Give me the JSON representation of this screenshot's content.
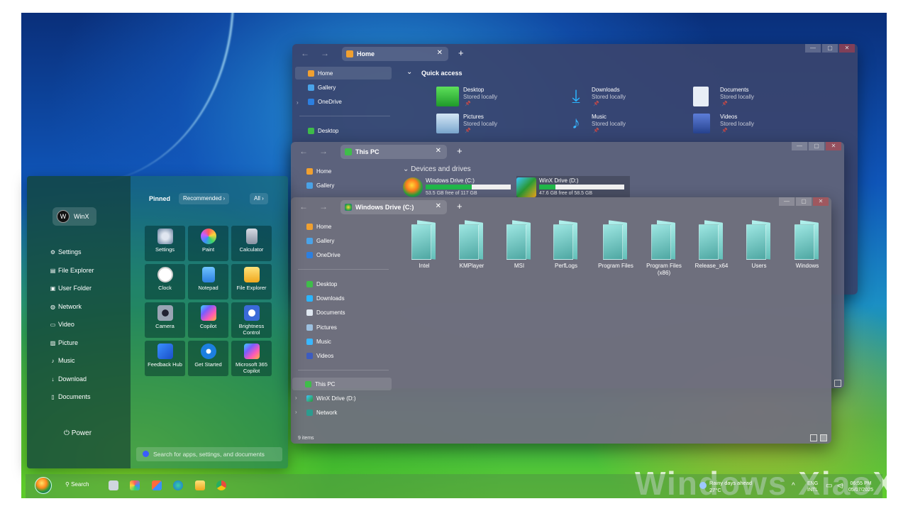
{
  "colors": {
    "accent_green": "#21b84a",
    "close_red": "#dc3c3c"
  },
  "home_window": {
    "tab_label": "Home",
    "sidebar": [
      "Home",
      "Gallery",
      "OneDrive",
      "Desktop"
    ],
    "quick_access_title": "Quick access",
    "items": [
      {
        "name": "Desktop",
        "sub": "Stored locally"
      },
      {
        "name": "Downloads",
        "sub": "Stored locally"
      },
      {
        "name": "Documents",
        "sub": "Stored locally"
      },
      {
        "name": "Pictures",
        "sub": "Stored locally"
      },
      {
        "name": "Music",
        "sub": "Stored locally"
      },
      {
        "name": "Videos",
        "sub": "Stored locally"
      }
    ]
  },
  "pc_window": {
    "tab_label": "This PC",
    "sidebar": [
      "Home",
      "Gallery"
    ],
    "section_title": "Devices and drives",
    "drives": [
      {
        "name": "Windows Drive (C:)",
        "free": "53.5 GB free of 117 GB",
        "used_fraction": 0.54
      },
      {
        "name": "WinX Drive (D:)",
        "free": "47.6 GB free of 58.5 GB",
        "used_fraction": 0.19
      }
    ]
  },
  "c_window": {
    "tab_label": "Windows Drive (C:)",
    "sidebar": [
      "Home",
      "Gallery",
      "OneDrive",
      "Desktop",
      "Downloads",
      "Documents",
      "Pictures",
      "Music",
      "Videos",
      "This PC",
      "WinX Drive (D:)",
      "Network"
    ],
    "folders": [
      "Intel",
      "KMPlayer",
      "MSI",
      "PerfLogs",
      "Program Files",
      "Program Files (x86)",
      "Release_x64",
      "Users",
      "Windows"
    ],
    "status": "9 items"
  },
  "start_menu": {
    "user_name": "WinX",
    "user_initial": "W",
    "left_items": [
      "Settings",
      "File Explorer",
      "User Folder",
      "Network",
      "Video",
      "Picture",
      "Music",
      "Download",
      "Documents"
    ],
    "power_label": "Power",
    "pinned_title": "Pinned",
    "recommended_label": "Recommended",
    "all_label": "All",
    "tiles": [
      "Settings",
      "Paint",
      "Calculator",
      "Clock",
      "Notepad",
      "File Explorer",
      "Camera",
      "Copilot",
      "Brightness Control",
      "Feedback Hub",
      "Get Started",
      "Microsoft 365 Copilot"
    ],
    "search_placeholder": "Search for apps, settings, and documents"
  },
  "taskbar": {
    "search_label": "Search",
    "weather_title": "Rainy days ahead",
    "weather_temp": "27°C",
    "lang_top": "ENG",
    "lang_bottom": "INTL",
    "time": "06:55 PM",
    "date": "05/07/2025"
  },
  "brand_text": "Windows XiaoXP"
}
